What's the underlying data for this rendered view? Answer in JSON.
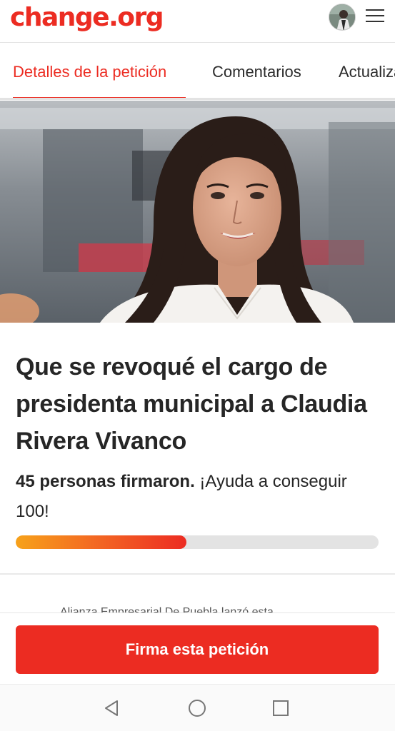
{
  "header": {
    "logo": "change.org",
    "avatar_icon": "user-avatar",
    "menu_icon": "hamburger-menu-icon"
  },
  "tabs": [
    {
      "label": "Detalles de la petición",
      "active": true
    },
    {
      "label": "Comentarios",
      "active": false
    },
    {
      "label": "Actualizaciones",
      "active": false
    }
  ],
  "petition": {
    "title": "Que se revoqué el cargo de presidenta municipal a Claudia Rivera Vivanco",
    "signed_bold": "45 personas firmaron.",
    "signed_rest": " ¡Ayuda a conseguir 100!",
    "signatures": 45,
    "goal": 100,
    "progress_fraction": 0.47,
    "starter_text": "Alianza Empresarial De Puebla lanzó esta"
  },
  "cta": {
    "sign_label": "Firma esta petición"
  },
  "system_nav": {
    "back_icon": "back-triangle-icon",
    "home_icon": "home-circle-icon",
    "recents_icon": "recents-square-icon"
  },
  "colors": {
    "brand": "#ec2c22",
    "progress_start": "#f7a21a",
    "progress_end": "#ec2c22"
  }
}
